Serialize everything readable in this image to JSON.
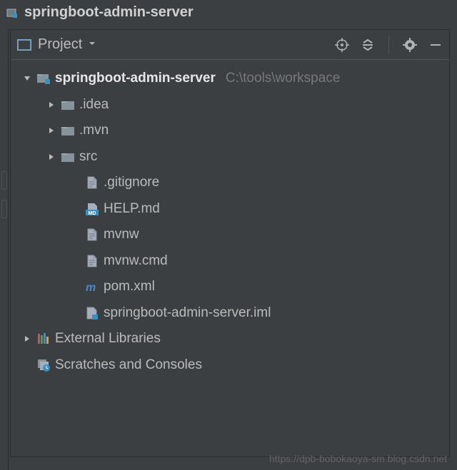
{
  "window": {
    "title": "springboot-admin-server"
  },
  "toolbar": {
    "view_label": "Project"
  },
  "tree": {
    "root": {
      "name": "springboot-admin-server",
      "path": "C:\\tools\\workspace"
    },
    "items": [
      {
        "label": ".idea",
        "type": "folder"
      },
      {
        "label": ".mvn",
        "type": "folder"
      },
      {
        "label": "src",
        "type": "folder"
      },
      {
        "label": ".gitignore",
        "type": "file"
      },
      {
        "label": "HELP.md",
        "type": "md"
      },
      {
        "label": "mvnw",
        "type": "file"
      },
      {
        "label": "mvnw.cmd",
        "type": "file"
      },
      {
        "label": "pom.xml",
        "type": "maven"
      },
      {
        "label": "springboot-admin-server.iml",
        "type": "iml"
      }
    ],
    "external_libs": "External Libraries",
    "scratches": "Scratches and Consoles"
  },
  "watermark": "https://dpb-bobokaoya-sm.blog.csdn.net"
}
